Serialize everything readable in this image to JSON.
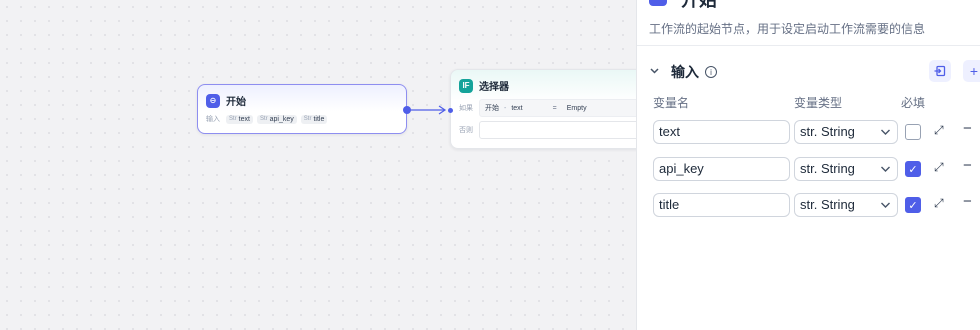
{
  "start_node": {
    "title": "开始",
    "input_label": "输入",
    "chips": [
      {
        "type": "Str",
        "name": "text"
      },
      {
        "type": "Str",
        "name": "api_key"
      },
      {
        "type": "Str",
        "name": "title"
      }
    ]
  },
  "if_node": {
    "badge": "IF",
    "title": "选择器",
    "if_label": "如果",
    "cond_source": "开始",
    "cond_sep": "-",
    "cond_var": "text",
    "cond_op": "=",
    "cond_value": "Empty",
    "else_label": "否则"
  },
  "panel": {
    "title": "开始",
    "description": "工作流的起始节点，用于设定启动工作流需要的信息",
    "section_title": "输入",
    "columns": {
      "name": "变量名",
      "type": "变量类型",
      "required": "必填"
    },
    "rows": [
      {
        "name": "text",
        "type": "str. String",
        "required": false
      },
      {
        "name": "api_key",
        "type": "str. String",
        "required": true
      },
      {
        "name": "title",
        "type": "str. String",
        "required": true
      }
    ]
  },
  "icons": {
    "close": "close-icon",
    "chevron": "chevron-down-icon",
    "info": "info-icon",
    "import": "import-icon",
    "add": "plus-icon",
    "expand": "expand-icon",
    "remove": "minus-icon",
    "check": "check-icon"
  },
  "colors": {
    "accent": "#4f5ee8",
    "if_badge": "#14a39a"
  }
}
